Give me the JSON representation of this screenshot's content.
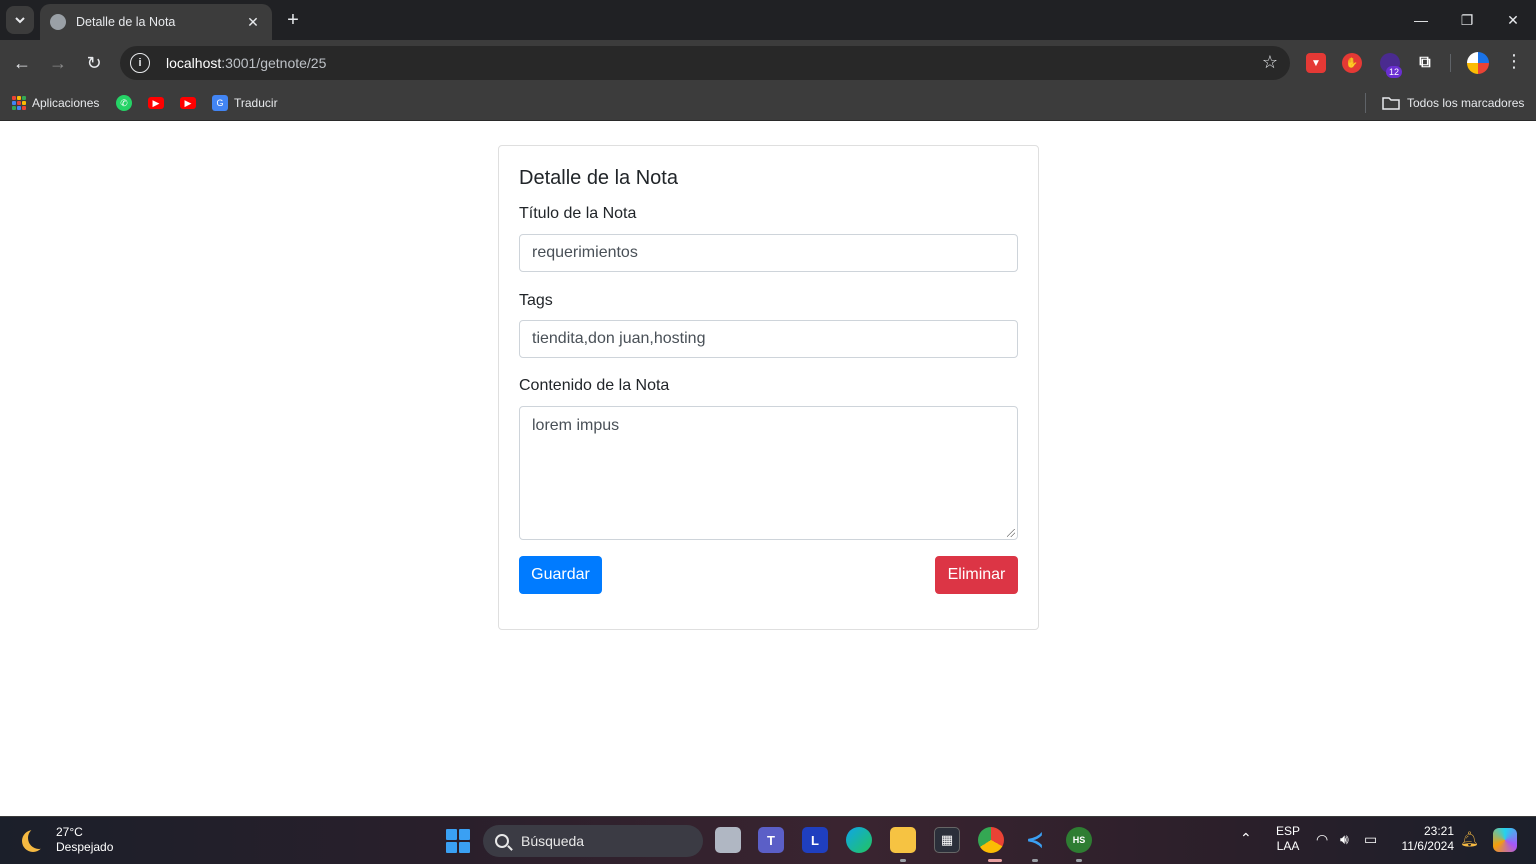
{
  "browser": {
    "tab_title": "Detalle de la Nota",
    "url_host": "localhost",
    "url_path": ":3001/getnote/25",
    "extension_badge": "12",
    "bookmarks": [
      {
        "label": "Aplicaciones",
        "icon": "apps-grid-icon"
      },
      {
        "label": "",
        "icon": "whatsapp-icon"
      },
      {
        "label": "",
        "icon": "youtube-icon"
      },
      {
        "label": "",
        "icon": "youtube-icon"
      },
      {
        "label": "Traducir",
        "icon": "google-translate-icon"
      }
    ],
    "all_bookmarks_label": "Todos los marcadores"
  },
  "note": {
    "heading": "Detalle de la Nota",
    "title_label": "Título de la Nota",
    "title_value": "requerimientos",
    "tags_label": "Tags",
    "tags_value": "tiendita,don juan,hosting",
    "content_label": "Contenido de la Nota",
    "content_value": "lorem impus",
    "save_button": "Guardar",
    "delete_button": "Eliminar"
  },
  "colors": {
    "primary": "#007bff",
    "danger": "#dc3545",
    "chrome_dark": "#202124",
    "chrome_toolbar": "#3c3c3c"
  },
  "taskbar": {
    "temperature": "27°C",
    "weather": "Despejado",
    "search_placeholder": "Búsqueda",
    "lang_top": "ESP",
    "lang_bottom": "LAA",
    "time": "23:21",
    "date": "11/6/2024",
    "apps": [
      "task-view-icon",
      "teams-icon",
      "l-app-icon",
      "edge-icon",
      "file-explorer-icon",
      "store-icon",
      "chrome-icon",
      "vscode-icon",
      "hs-app-icon"
    ]
  }
}
